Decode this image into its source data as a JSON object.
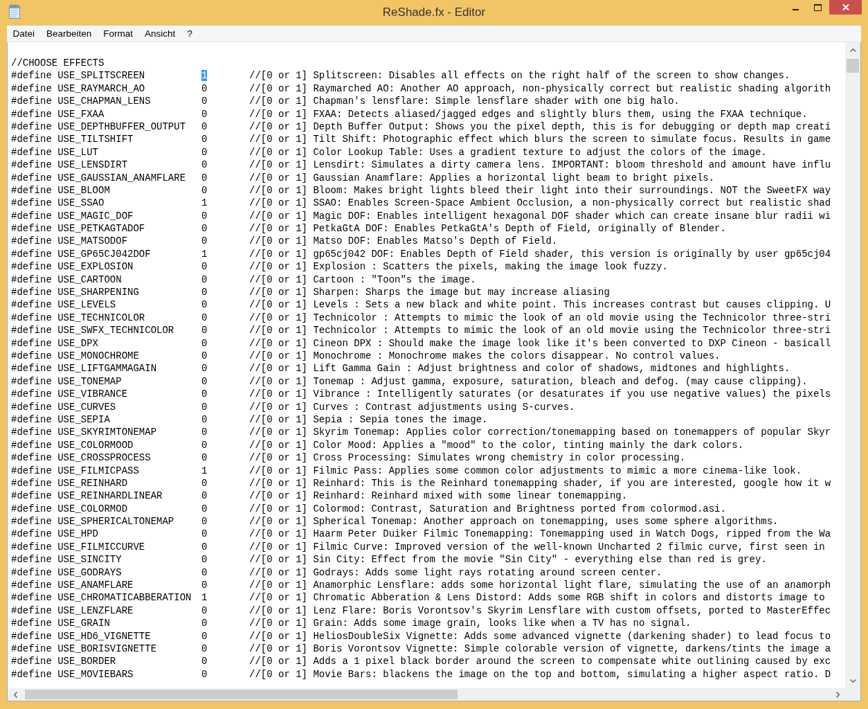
{
  "window": {
    "title": "ReShade.fx - Editor"
  },
  "menu": [
    {
      "label": "Datei"
    },
    {
      "label": "Bearbeiten"
    },
    {
      "label": "Format"
    },
    {
      "label": "Ansicht"
    },
    {
      "label": "?"
    }
  ],
  "editor": {
    "lines": [
      {
        "kind": "comment",
        "text": "//CHOOSE EFFECTS",
        "selected": false
      },
      {
        "kind": "define",
        "name": "#define USE_SPLITSCREEN",
        "value": "1",
        "selected": true,
        "comment": "//[0 or 1] Splitscreen: Disables all effects on the right half of the screen to show changes."
      },
      {
        "kind": "define",
        "name": "#define USE_RAYMARCH_AO",
        "value": "0",
        "selected": false,
        "comment": "//[0 or 1] Raymarched AO: Another AO approach, non-physically correct but realistic shading algorith"
      },
      {
        "kind": "define",
        "name": "#define USE_CHAPMAN_LENS",
        "value": "0",
        "selected": false,
        "comment": "//[0 or 1] Chapman's lensflare: Simple lensflare shader with one big halo."
      },
      {
        "kind": "define",
        "name": "#define USE_FXAA",
        "value": "0",
        "selected": false,
        "comment": "//[0 or 1] FXAA: Detects aliased/jagged edges and slightly blurs them, using the FXAA technique."
      },
      {
        "kind": "define",
        "name": "#define USE_DEPTHBUFFER_OUTPUT",
        "value": "0",
        "selected": false,
        "comment": "//[0 or 1] Depth Buffer Output: Shows you the pixel depth, this is for debugging or depth map creati"
      },
      {
        "kind": "define",
        "name": "#define USE_TILTSHIFT",
        "value": "0",
        "selected": false,
        "comment": "//[0 or 1] Tilt Shift: Photographic effect which blurs the screen to simulate focus. Results in game"
      },
      {
        "kind": "define",
        "name": "#define USE_LUT",
        "value": "0",
        "selected": false,
        "comment": "//[0 or 1] Color Lookup Table: Uses a gradient texture to adjust the colors of the image."
      },
      {
        "kind": "define",
        "name": "#define USE_LENSDIRT",
        "value": "0",
        "selected": false,
        "comment": "//[0 or 1] Lensdirt: Simulates a dirty camera lens. IMPORTANT: bloom threshold and amount have influ"
      },
      {
        "kind": "define",
        "name": "#define USE_GAUSSIAN_ANAMFLARE",
        "value": "0",
        "selected": false,
        "comment": "//[0 or 1] Gaussian Anamflare: Applies a horizontal light beam to bright pixels."
      },
      {
        "kind": "define",
        "name": "#define USE_BLOOM",
        "value": "0",
        "selected": false,
        "comment": "//[0 or 1] Bloom: Makes bright lights bleed their light into their surroundings. NOT the SweetFX way"
      },
      {
        "kind": "define",
        "name": "#define USE_SSAO",
        "value": "1",
        "selected": false,
        "comment": "//[0 or 1] SSAO: Enables Screen-Space Ambient Occlusion, a non-physically correct but realistic shad"
      },
      {
        "kind": "define",
        "name": "#define USE_MAGIC_DOF",
        "value": "0",
        "selected": false,
        "comment": "//[0 or 1] Magic DOF: Enables intelligent hexagonal DOF shader which can create insane blur radii wi"
      },
      {
        "kind": "define",
        "name": "#define USE_PETKAGTADOF",
        "value": "0",
        "selected": false,
        "comment": "//[0 or 1] PetkaGtA DOF: Enables PetkaGtA's Depth of Field, originally of Blender."
      },
      {
        "kind": "define",
        "name": "#define USE_MATSODOF",
        "value": "0",
        "selected": false,
        "comment": "//[0 or 1] Matso DOF: Enables Matso's Depth of Field."
      },
      {
        "kind": "define",
        "name": "#define USE_GP65CJ042DOF",
        "value": "1",
        "selected": false,
        "comment": "//[0 or 1] gp65cj042 DOF: Enables Depth of Field shader, this version is originally by user gp65cj04"
      },
      {
        "kind": "define",
        "name": "#define USE_EXPLOSION",
        "value": "0",
        "selected": false,
        "comment": "//[0 or 1] Explosion : Scatters the pixels, making the image look fuzzy."
      },
      {
        "kind": "define",
        "name": "#define USE_CARTOON",
        "value": "0",
        "selected": false,
        "comment": "//[0 or 1] Cartoon : \"Toon\"s the image."
      },
      {
        "kind": "define",
        "name": "#define USE_SHARPENING",
        "value": "0",
        "selected": false,
        "comment": "//[0 or 1] Sharpen: Sharps the image but may increase aliasing"
      },
      {
        "kind": "define",
        "name": "#define USE_LEVELS",
        "value": "0",
        "selected": false,
        "comment": "//[0 or 1] Levels : Sets a new black and white point. This increases contrast but causes clipping. U"
      },
      {
        "kind": "define",
        "name": "#define USE_TECHNICOLOR",
        "value": "0",
        "selected": false,
        "comment": "//[0 or 1] Technicolor : Attempts to mimic the look of an old movie using the Technicolor three-stri"
      },
      {
        "kind": "define",
        "name": "#define USE_SWFX_TECHNICOLOR",
        "value": "0",
        "selected": false,
        "comment": "//[0 or 1] Technicolor : Attempts to mimic the look of an old movie using the Technicolor three-stri"
      },
      {
        "kind": "define",
        "name": "#define USE_DPX",
        "value": "0",
        "selected": false,
        "comment": "//[0 or 1] Cineon DPX : Should make the image look like it's been converted to DXP Cineon - basicall"
      },
      {
        "kind": "define",
        "name": "#define USE_MONOCHROME",
        "value": "0",
        "selected": false,
        "comment": "//[0 or 1] Monochrome : Monochrome makes the colors disappear. No control values."
      },
      {
        "kind": "define",
        "name": "#define USE_LIFTGAMMAGAIN",
        "value": "0",
        "selected": false,
        "comment": "//[0 or 1] Lift Gamma Gain : Adjust brightness and color of shadows, midtones and highlights."
      },
      {
        "kind": "define",
        "name": "#define USE_TONEMAP",
        "value": "0",
        "selected": false,
        "comment": "//[0 or 1] Tonemap : Adjust gamma, exposure, saturation, bleach and defog. (may cause clipping)."
      },
      {
        "kind": "define",
        "name": "#define USE_VIBRANCE",
        "value": "0",
        "selected": false,
        "comment": "//[0 or 1] Vibrance : Intelligently saturates (or desaturates if you use negative values) the pixels"
      },
      {
        "kind": "define",
        "name": "#define USE_CURVES",
        "value": "0",
        "selected": false,
        "comment": "//[0 or 1] Curves : Contrast adjustments using S-curves."
      },
      {
        "kind": "define",
        "name": "#define USE_SEPIA",
        "value": "0",
        "selected": false,
        "comment": "//[0 or 1] Sepia : Sepia tones the image."
      },
      {
        "kind": "define",
        "name": "#define USE_SKYRIMTONEMAP",
        "value": "0",
        "selected": false,
        "comment": "//[0 or 1] Skyrim Tonemap: Applies color correction/tonemapping based on tonemappers of popular Skyr"
      },
      {
        "kind": "define",
        "name": "#define USE_COLORMOOD",
        "value": "0",
        "selected": false,
        "comment": "//[0 or 1] Color Mood: Applies a \"mood\" to the color, tinting mainly the dark colors."
      },
      {
        "kind": "define",
        "name": "#define USE_CROSSPROCESS",
        "value": "0",
        "selected": false,
        "comment": "//[0 or 1] Cross Processing: Simulates wrong chemistry in color processing."
      },
      {
        "kind": "define",
        "name": "#define USE_FILMICPASS",
        "value": "1",
        "selected": false,
        "comment": "//[0 or 1] Filmic Pass: Applies some common color adjustments to mimic a more cinema-like look."
      },
      {
        "kind": "define",
        "name": "#define USE_REINHARD",
        "value": "0",
        "selected": false,
        "comment": "//[0 or 1] Reinhard: This is the Reinhard tonemapping shader, if you are interested, google how it w"
      },
      {
        "kind": "define",
        "name": "#define USE_REINHARDLINEAR",
        "value": "0",
        "selected": false,
        "comment": "//[0 or 1] Reinhard: Reinhard mixed with some linear tonemapping."
      },
      {
        "kind": "define",
        "name": "#define USE_COLORMOD",
        "value": "0",
        "selected": false,
        "comment": "//[0 or 1] Colormod: Contrast, Saturation and Brightness ported from colormod.asi."
      },
      {
        "kind": "define",
        "name": "#define USE_SPHERICALTONEMAP",
        "value": "0",
        "selected": false,
        "comment": "//[0 or 1] Spherical Tonemap: Another approach on tonemapping, uses some sphere algorithms."
      },
      {
        "kind": "define",
        "name": "#define USE_HPD",
        "value": "0",
        "selected": false,
        "comment": "//[0 or 1] Haarm Peter Duiker Filmic Tonemapping: Tonemapping used in Watch Dogs, ripped from the Wa"
      },
      {
        "kind": "define",
        "name": "#define USE_FILMICCURVE",
        "value": "0",
        "selected": false,
        "comment": "//[0 or 1] Filmic Curve: Improved version of the well-known Uncharted 2 filmic curve, first seen in"
      },
      {
        "kind": "define",
        "name": "#define USE_SINCITY",
        "value": "0",
        "selected": false,
        "comment": "//[0 or 1] Sin City: Effect from the movie \"Sin City\" - everything else than red is grey."
      },
      {
        "kind": "define",
        "name": "#define USE_GODRAYS",
        "value": "0",
        "selected": false,
        "comment": "//[0 or 1] Godrays: Adds some light rays rotating around screen center."
      },
      {
        "kind": "define",
        "name": "#define USE_ANAMFLARE",
        "value": "0",
        "selected": false,
        "comment": "//[0 or 1] Anamorphic Lensflare: adds some horizontal light flare, simulating the use of an anamorph"
      },
      {
        "kind": "define",
        "name": "#define USE_CHROMATICABBERATION",
        "value": "1",
        "selected": false,
        "comment": "//[0 or 1] Chromatic Abberation & Lens Distord: Adds some RGB shift in colors and distorts image to"
      },
      {
        "kind": "define",
        "name": "#define USE_LENZFLARE",
        "value": "0",
        "selected": false,
        "comment": "//[0 or 1] Lenz Flare: Boris Vorontsov's Skyrim Lensflare with custom offsets, ported to MasterEffec"
      },
      {
        "kind": "define",
        "name": "#define USE_GRAIN",
        "value": "0",
        "selected": false,
        "comment": "//[0 or 1] Grain: Adds some image grain, looks like when a TV has no signal."
      },
      {
        "kind": "define",
        "name": "#define USE_HD6_VIGNETTE",
        "value": "0",
        "selected": false,
        "comment": "//[0 or 1] HeliosDoubleSix Vignette: Adds some advanced vignette (darkening shader) to lead focus to"
      },
      {
        "kind": "define",
        "name": "#define USE_BORISVIGNETTE",
        "value": "0",
        "selected": false,
        "comment": "//[0 or 1] Boris Vorontsov Vignette: Simple colorable version of vignette, darkens/tints the image a"
      },
      {
        "kind": "define",
        "name": "#define USE_BORDER",
        "value": "0",
        "selected": false,
        "comment": "//[0 or 1] Adds a 1 pixel black border around the screen to compensate white outlining caused by exc"
      },
      {
        "kind": "define",
        "name": "#define USE_MOVIEBARS",
        "value": "0",
        "selected": false,
        "comment": "//[0 or 1] Movie Bars: blackens the image on the top and bottom, simulating a higher aspect ratio. D"
      }
    ]
  }
}
